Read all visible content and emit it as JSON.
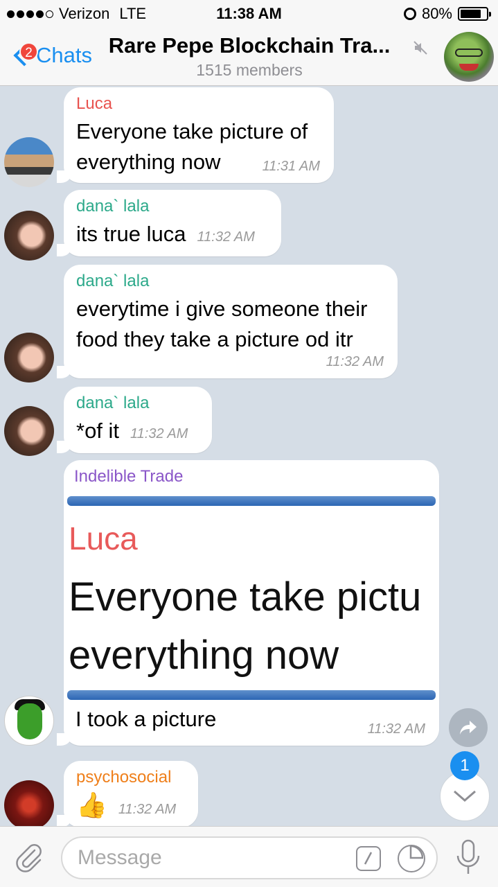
{
  "status_bar": {
    "carrier": "Verizon",
    "network": "LTE",
    "time": "11:38 AM",
    "battery": "80%",
    "battery_level": 0.8
  },
  "header": {
    "back_label": "Chats",
    "unread_badge": "2",
    "title": "Rare Pepe Blockchain Tra...",
    "subtitle": "1515 members"
  },
  "messages": [
    {
      "sender": "Luca",
      "sender_color": "#e8534f",
      "text_lines": [
        "Everyone take picture of",
        "everything now"
      ],
      "time": "11:31 AM"
    },
    {
      "sender": "dana` lala",
      "sender_color": "#2ca98a",
      "text_lines": [
        "its true luca"
      ],
      "time": "11:32 AM"
    },
    {
      "sender": "dana` lala",
      "sender_color": "#2ca98a",
      "text_lines": [
        "everytime i give someone their",
        "food they take a picture od itr"
      ],
      "time": "11:32 AM"
    },
    {
      "sender": "dana` lala",
      "sender_color": "#2ca98a",
      "text_lines": [
        "*of it"
      ],
      "time": "11:32 AM"
    },
    {
      "sender": "Indelible Trade",
      "sender_color": "#8a56c8",
      "image_name": "Luca",
      "image_text_lines": [
        "Everyone take pictu",
        "everything now"
      ],
      "text_lines": [
        "I took a picture"
      ],
      "time": "11:32 AM"
    },
    {
      "sender": "psychosocial",
      "sender_color": "#ef7f1a",
      "text_lines": [
        "👍"
      ],
      "time": "11:32 AM"
    }
  ],
  "scroll_badge": "1",
  "input": {
    "placeholder": "Message",
    "value": ""
  }
}
